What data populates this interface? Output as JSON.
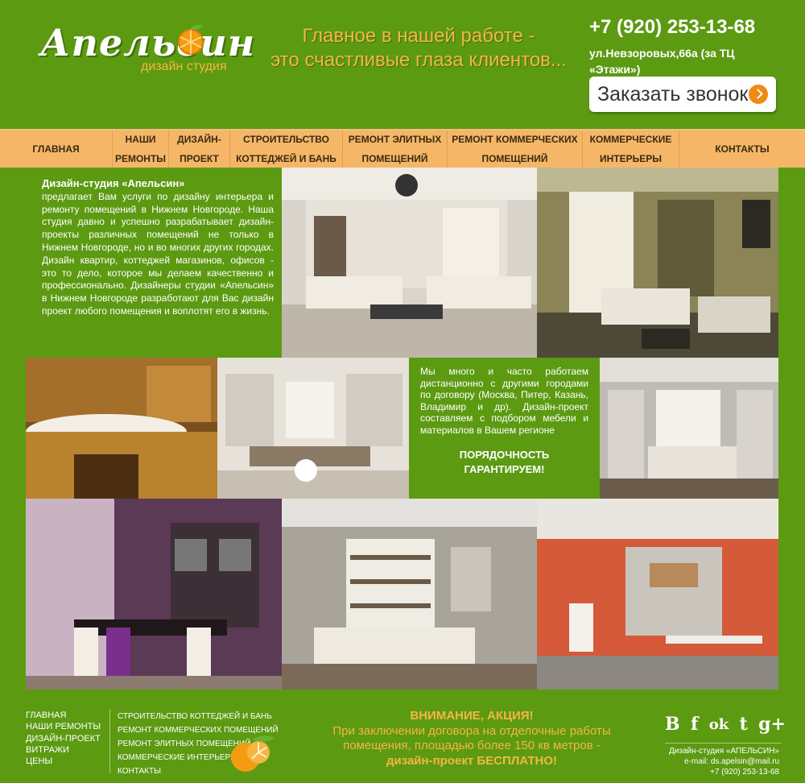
{
  "header": {
    "logo_name": "Апельсин",
    "logo_sub": "дизайн студия",
    "slogan_line1": "Главное в нашей работе -",
    "slogan_line2": "это счастливые глаза клиентов...",
    "phone": "+7 (920) 253-13-68",
    "address": "ул.Невзоровых,66а (за ТЦ «Этажи»)",
    "callback_label": "Заказать звонок"
  },
  "nav": {
    "items": [
      {
        "label": "ГЛАВНАЯ"
      },
      {
        "label": "НАШИ РЕМОНТЫ"
      },
      {
        "label": "ДИЗАЙН-ПРОЕКТ"
      },
      {
        "label": "СТРОИТЕЛЬСТВО КОТТЕДЖЕЙ И БАНЬ"
      },
      {
        "label": "РЕМОНТ ЭЛИТНЫХ ПОМЕЩЕНИЙ"
      },
      {
        "label": "РЕМОНТ КОММЕРЧЕСКИХ ПОМЕЩЕНИЙ"
      },
      {
        "label": "КОММЕРЧЕСКИЕ ИНТЕРЬЕРЫ"
      },
      {
        "label": "КОНТАКТЫ"
      }
    ]
  },
  "intro": {
    "title": "Дизайн-студия «Апельсин»",
    "body": "предлагает Вам услуги по дизайну интерьера и ремонту помещений в Нижнем Новгороде. Наша студия давно и успешно разрабатывает дизайн-проекты различных помещений не только в Нижнем Новгороде, но и во многих других городах. Дизайн квартир, коттеджей магазинов, офисов - это то дело, которое мы делаем качественно и профессионально. Дизайнеры студии «Апельсин» в Нижнем Новгороде разработают для Вас дизайн проект любого помещения и воплотят его в жизнь."
  },
  "remote": {
    "body": "Мы много и часто работаем дистанционно с другими городами по договору (Москва, Питер, Казань, Владимир и др). Дизайн-проект составляем с подбором мебели и материалов в Вашем регионе",
    "guarantee_line1": "ПОРЯДОЧНОСТЬ",
    "guarantee_line2": "ГАРАНТИРУЕМ!"
  },
  "footer": {
    "col1": [
      "ГЛАВНАЯ",
      "НАШИ РЕМОНТЫ",
      "ДИЗАЙН-ПРОЕКТ",
      "ВИТРАЖИ",
      "ЦЕНЫ"
    ],
    "col2": [
      "СТРОИТЕЛЬСТВО КОТТЕДЖЕЙ И БАНЬ",
      "РЕМОНТ КОММЕРЧЕСКИХ ПОМЕЩЕНИЙ",
      "РЕМОНТ ЭЛИТНЫХ ПОМЕЩЕНИЙ",
      "КОММЕРЧЕСКИЕ ИНТЕРЬЕРЫ",
      "КОНТАКТЫ"
    ],
    "promo_title": "ВНИМАНИЕ, АКЦИЯ!",
    "promo_line1": "При заключении договора на отделочные работы",
    "promo_line2": "помещения, площадью более 150 кв метров -",
    "promo_line3": "дизайн-проект БЕСПЛАТНО!",
    "socials": [
      {
        "icon": "vk-icon",
        "glyph": "В"
      },
      {
        "icon": "facebook-icon",
        "glyph": "f"
      },
      {
        "icon": "odnoklassniki-icon",
        "glyph": "ok"
      },
      {
        "icon": "twitter-icon",
        "glyph": "t"
      },
      {
        "icon": "googleplus-icon",
        "glyph": "g+"
      }
    ],
    "studio": "Дизайн-студия «АПЕЛЬСИН»",
    "email": "e-mail: ds.apelsin@mail.ru",
    "phone": "+7 (920) 253-13-68"
  },
  "colors": {
    "background": "#5c9a12",
    "nav": "#f5b668",
    "accent_orange": "#f5b642",
    "button_arrow": "#f08a12"
  }
}
